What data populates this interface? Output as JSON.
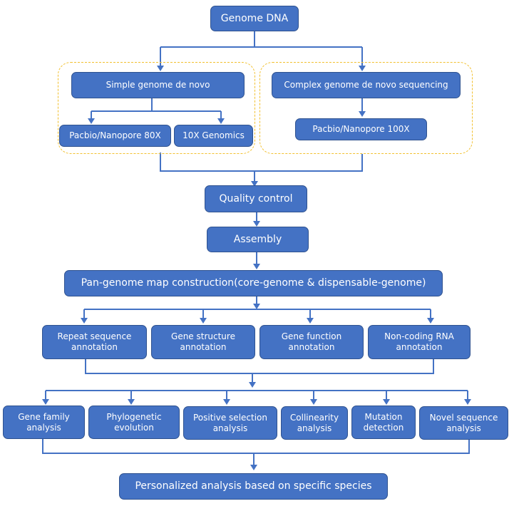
{
  "diagram": {
    "root": "Genome DNA",
    "branches": {
      "simple": {
        "title": "Simple genome de novo",
        "children": [
          "Pacbio/Nanopore 80X",
          "10X Genomics"
        ]
      },
      "complex": {
        "title": "Complex genome de novo sequencing",
        "children": [
          "Pacbio/Nanopore 100X"
        ]
      }
    },
    "pipeline": [
      "Quality control",
      "Assembly",
      "Pan-genome map construction(core-genome & dispensable-genome)"
    ],
    "annotations": [
      "Repeat sequence annotation",
      "Gene structure annotation",
      "Gene function annotation",
      "Non-coding RNA annotation"
    ],
    "analyses": [
      "Gene family analysis",
      "Phylogenetic evolution",
      "Positive selection analysis",
      "Collinearity analysis",
      "Mutation detection",
      "Novel sequence analysis"
    ],
    "final": "Personalized analysis based on specific species",
    "colors": {
      "box_fill": "#4472c4",
      "box_border": "#2f528f",
      "group_border": "#f2c02e",
      "connector": "#4472c4"
    }
  }
}
